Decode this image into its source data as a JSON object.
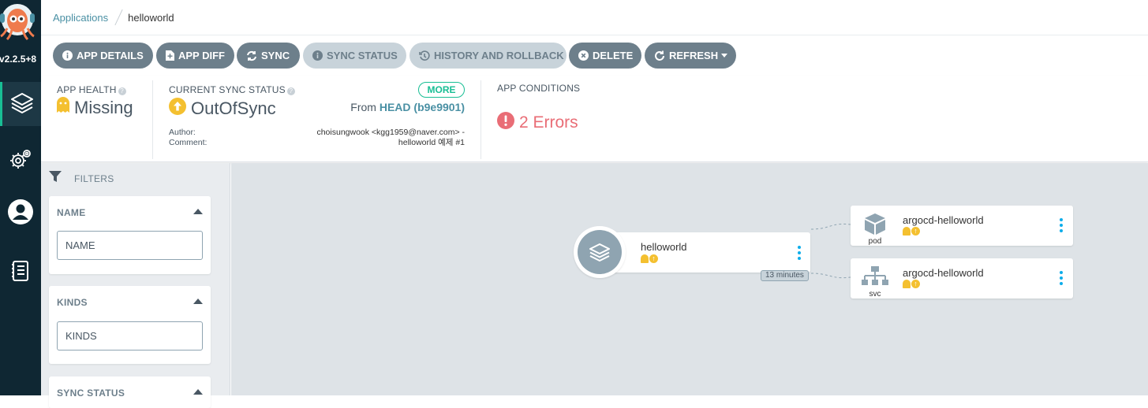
{
  "sidebar": {
    "version": "v2.2.5+8",
    "items": [
      {
        "name": "applications"
      },
      {
        "name": "settings"
      },
      {
        "name": "user-info"
      },
      {
        "name": "documentation"
      }
    ]
  },
  "breadcrumb": {
    "parent": "Applications",
    "current": "helloworld"
  },
  "toolbar": {
    "app_details": "APP DETAILS",
    "app_diff": "APP DIFF",
    "sync": "SYNC",
    "sync_status": "SYNC STATUS",
    "history_rollback": "HISTORY AND ROLLBACK",
    "delete": "DELETE",
    "refresh": "REFRESH"
  },
  "status": {
    "app_health_label": "APP HEALTH",
    "app_health_value": "Missing",
    "sync_label": "CURRENT SYNC STATUS",
    "more_label": "MORE",
    "sync_value": "OutOfSync",
    "from_prefix": "From",
    "from_ref": "HEAD (b9e9901)",
    "author_label": "Author:",
    "author_value": "choisungwook <kgg1959@naver.com> -",
    "comment_label": "Comment:",
    "comment_value": "helloworld 예제 #1",
    "conditions_label": "APP CONDITIONS",
    "conditions_value": "2 Errors"
  },
  "filters": {
    "header": "FILTERS",
    "name_title": "NAME",
    "name_placeholder": "NAME",
    "kinds_title": "KINDS",
    "kinds_placeholder": "KINDS",
    "sync_title": "SYNC STATUS"
  },
  "graph": {
    "root": {
      "name": "helloworld",
      "age": "13 minutes"
    },
    "children": [
      {
        "name": "argocd-helloworld",
        "kind": "pod"
      },
      {
        "name": "argocd-helloworld",
        "kind": "svc"
      }
    ]
  },
  "colors": {
    "sidebar_bg": "#0f2733",
    "button": "#6d7f8b",
    "button_disabled": "#c8d3da",
    "teal": "#18be94",
    "link": "#4a90a4",
    "missing": "#f4c030",
    "error": "#e96d76",
    "kebab": "#0dadea"
  }
}
